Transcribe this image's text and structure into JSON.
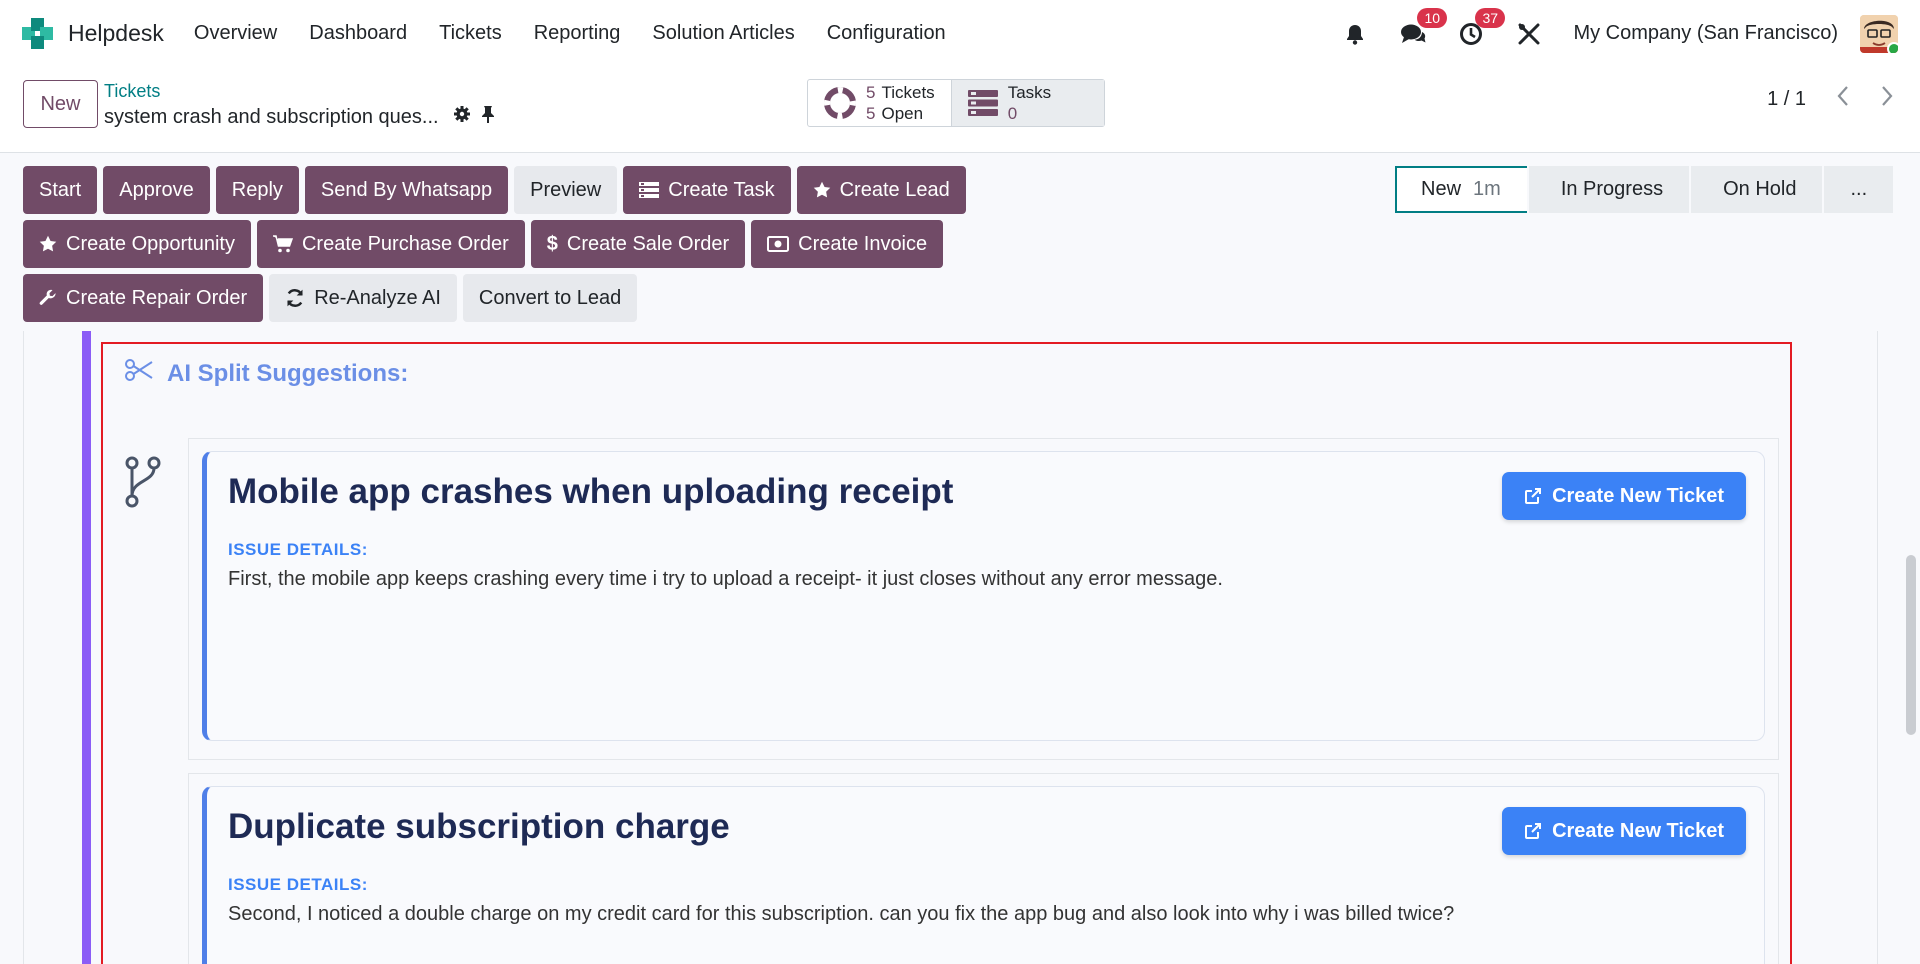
{
  "navbar": {
    "app_name": "Helpdesk",
    "menu": [
      "Overview",
      "Dashboard",
      "Tickets",
      "Reporting",
      "Solution Articles",
      "Configuration"
    ],
    "messages_count": "10",
    "activities_count": "37",
    "company": "My Company (San Francisco)"
  },
  "control_panel": {
    "new_label": "New",
    "breadcrumb": "Tickets",
    "record_title": "system crash and subscription ques...",
    "stat_tickets_count": "5",
    "stat_tickets_label": "Tickets",
    "stat_open_count": "5",
    "stat_open_label": "Open",
    "stat_tasks_label": "Tasks",
    "stat_tasks_count": "0",
    "pager": "1 / 1"
  },
  "actions": {
    "row1": [
      "Start",
      "Approve",
      "Reply",
      "Send By Whatsapp",
      "Preview",
      "Create Task",
      "Create Lead"
    ],
    "row2": [
      "Create Opportunity",
      "Create Purchase Order",
      "Create Sale Order",
      "Create Invoice"
    ],
    "row3": [
      "Create Repair Order",
      "Re-Analyze AI",
      "Convert to Lead"
    ]
  },
  "status_bar": {
    "stages": [
      "New",
      "In Progress",
      "On Hold",
      "..."
    ],
    "active_duration": "1m"
  },
  "ai_split": {
    "heading": "AI Split Suggestions:",
    "details_label": "ISSUE DETAILS:",
    "button_label": "Create New Ticket",
    "suggestions": [
      {
        "title": "Mobile app crashes when uploading receipt",
        "details": "First, the mobile app keeps crashing every time i try to upload a receipt- it just closes without any error message."
      },
      {
        "title": "Duplicate subscription charge",
        "details": "Second, I noticed a double charge on my credit card for this subscription. can you fix the app bug and also look into why i was billed twice?"
      }
    ]
  },
  "colors": {
    "brand_primary": "#714b67",
    "accent_teal": "#017e84",
    "ai_blue": "#3b82f6",
    "highlight_red": "#e31b23",
    "purple_bar": "#8b5cf6"
  }
}
